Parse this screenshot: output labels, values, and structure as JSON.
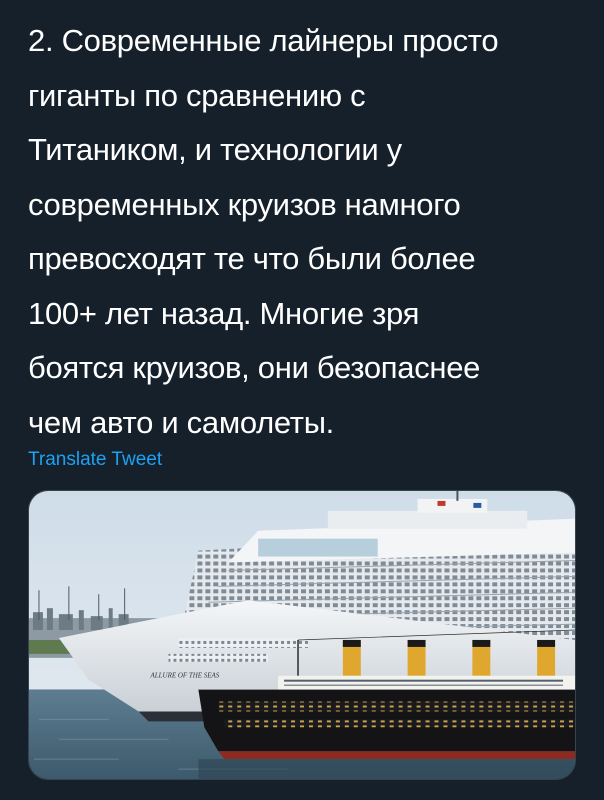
{
  "tweet": {
    "text_lines": [
      "2. Современные лайнеры просто",
      "гиганты по сравнению с",
      "Титаником, и технологии у",
      "современных круизов намного",
      "превосходят те что были более",
      "100+ лет назад. Многие зря",
      "боятся круизов, они безопаснее",
      "чем авто и самолеты."
    ],
    "translate_label": "Translate Tweet"
  },
  "media": {
    "ship_name_on_hull": "ALLURE OF THE SEAS"
  },
  "colors": {
    "background": "#15202b",
    "text": "#ffffff",
    "link": "#1da1f2",
    "media_border": "#38444d"
  }
}
